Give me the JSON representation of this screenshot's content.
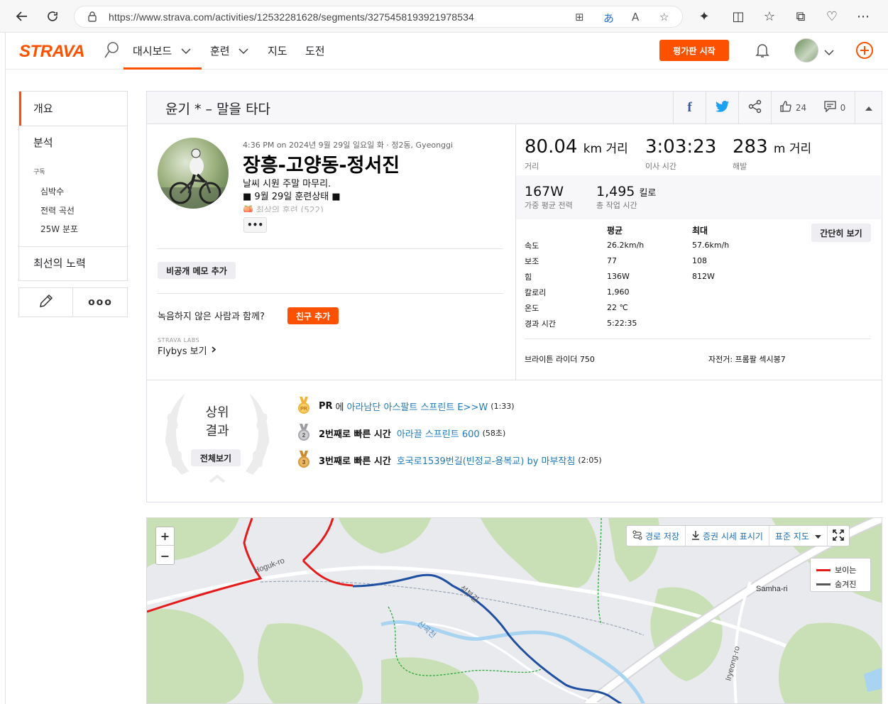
{
  "browser": {
    "url": "https://www.strava.com/activities/12532281628/segments/3275458193921978534"
  },
  "nav": {
    "logo": "STRAVA",
    "items": [
      "대시보드",
      "훈련",
      "지도",
      "도전"
    ],
    "trial_button": "평가판 시작"
  },
  "sidebar": {
    "items": [
      "개요",
      "분석"
    ],
    "section_label": "구독",
    "sub_items": [
      "심박수",
      "전력 곡선",
      "25W 분포"
    ],
    "best_efforts": "최선의 노력"
  },
  "activity": {
    "title": "윤기 * – 말을 타다",
    "kudos_count": "24",
    "comment_count": "0",
    "meta": "4:36 PM on 2024년 9월 29일 일요일 화 · 정2동, Gyeonggi",
    "name": "장흥-고양동-정서진",
    "description_lines": [
      "날씨 시원 주말 마무리.",
      "■ 9월 29일 훈련상태 ■",
      "🍑 최상의 훈련 (522)"
    ],
    "more": "•••",
    "private_note": "비공개 메모 추가",
    "unrecorded_question": "녹음하지 않은 사람과 함께?",
    "add_friend": "친구 추가",
    "labs": "STRAVA LABS",
    "flybys": "Flybys 보기"
  },
  "stats": {
    "distance_value": "80.04",
    "distance_unit": "km 거리",
    "distance_label": "거리",
    "moving_time_value": "3:03:23",
    "moving_time_label": "이사 시간",
    "elevation_value": "283",
    "elevation_unit": "m 거리",
    "elevation_label": "해발",
    "power_value": "167W",
    "power_label": "가중 평균 전력",
    "work_value": "1,495",
    "work_unit": "킬로",
    "work_label": "총 작업 시간",
    "col_avg": "평균",
    "col_max": "최대",
    "simple_view": "간단히 보기",
    "rows": [
      {
        "label": "속도",
        "avg": "26.2km/h",
        "max": "57.6km/h"
      },
      {
        "label": "보조",
        "avg": "77",
        "max": "108"
      },
      {
        "label": "힘",
        "avg": "136W",
        "max": "812W"
      },
      {
        "label": "칼로리",
        "avg": "1,960",
        "max": ""
      },
      {
        "label": "온도",
        "avg": "22 ℃",
        "max": ""
      },
      {
        "label": "경과 시간",
        "avg": "5:22:35",
        "max": ""
      }
    ],
    "device": "브라이튼 라이더 750",
    "bike": "자전거: 프롬팔 섹시봉7"
  },
  "achievements": {
    "heading_line1": "상위",
    "heading_line2": "결과",
    "view_all": "전체보기",
    "items": [
      {
        "medal": "PR",
        "prefix": "PR",
        "mid": "에",
        "segment": "아라남단 아스팔트 스프린트 E>>W",
        "time": "(1:33)",
        "color": "#f2b33d"
      },
      {
        "medal": "2",
        "prefix": "2번째로 빠른 시간",
        "mid": "",
        "segment": "아라끌 스프린트 600",
        "time": "(58초)",
        "color": "#a9a9ae"
      },
      {
        "medal": "3",
        "prefix": "3번째로 빠른 시간",
        "mid": "",
        "segment": "호국로1539번길(빈정교-용복교) by 마부작침",
        "time": "(2:05)",
        "color": "#d9993a"
      }
    ]
  },
  "map": {
    "zoom_in": "+",
    "zoom_out": "−",
    "save_route": "경로 저장",
    "export": "증권 시세 표시기",
    "map_type": "표준 지도",
    "legend_visible": "보이는",
    "legend_hidden": "숨겨진",
    "labels": {
      "hoguk": "Hoguk-ro",
      "samha": "Samha-ri",
      "iryeong": "Iryeong-ro",
      "seongbu": "석부길",
      "singok": "신곡천"
    },
    "colors": {
      "visible": "#e31b1b",
      "hidden": "#555555",
      "route": "#1f4fa0"
    }
  }
}
